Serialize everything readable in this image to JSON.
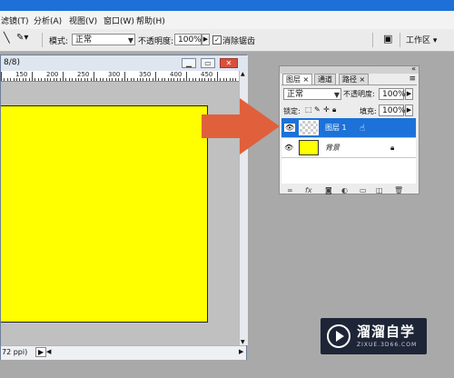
{
  "menu": {
    "items": [
      "滤镜(T)",
      "分析(A)",
      "视图(V)",
      "窗口(W)",
      "帮助(H)"
    ]
  },
  "options": {
    "mode_label": "模式:",
    "mode_value": "正常",
    "opacity_label": "不透明度:",
    "opacity_value": "100%",
    "antialias_label": "消除锯齿",
    "workspace_label": "工作区"
  },
  "document": {
    "title_fragment": "8/8)",
    "status_text": "72 ppi)",
    "ruler_labels": [
      "150",
      "200",
      "250",
      "300",
      "350",
      "400",
      "450"
    ],
    "canvas_color": "#ffff00"
  },
  "layers_panel": {
    "tabs": [
      "图层",
      "通道",
      "路径"
    ],
    "blend_mode": "正常",
    "opacity_label": "不透明度:",
    "opacity_value": "100%",
    "lock_label": "锁定:",
    "fill_label": "填充:",
    "fill_value": "100%",
    "layers": [
      {
        "name": "图层 1",
        "selected": true
      },
      {
        "name": "背景",
        "selected": false
      }
    ]
  },
  "watermark": {
    "name": "溜溜自学",
    "url": "ZIXUE.3D66.COM"
  },
  "colors": {
    "accent": "#1c72d8",
    "arrow": "#e0603c"
  }
}
